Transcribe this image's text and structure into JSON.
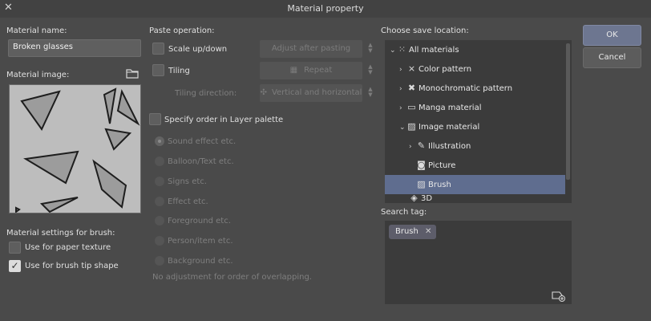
{
  "window": {
    "title": "Material property"
  },
  "left": {
    "material_name_label": "Material name:",
    "material_name_value": "Broken glasses",
    "material_image_label": "Material image:",
    "brush_settings_label": "Material settings for brush:",
    "paper_texture_label": "Use for paper texture",
    "paper_texture_checked": false,
    "brush_tip_label": "Use for brush tip shape",
    "brush_tip_checked": true,
    "check_mark": "✓"
  },
  "paste": {
    "label": "Paste operation:",
    "scale_label": "Scale up/down",
    "scale_value": "Adjust after pasting",
    "tiling_label": "Tiling",
    "tiling_value": "Repeat",
    "tiling_direction_label": "Tiling direction:",
    "tiling_direction_value": "Vertical and horizontal",
    "specify_order_label": "Specify order in Layer palette",
    "order_options": [
      "Sound effect etc.",
      "Balloon/Text etc.",
      "Signs etc.",
      "Effect etc.",
      "Foreground etc.",
      "Person/item etc.",
      "Background etc."
    ],
    "order_note": "No adjustment for order of overlapping."
  },
  "save": {
    "label": "Choose save location:",
    "tree": {
      "all_materials": "All materials",
      "color_pattern": "Color pattern",
      "monochromatic_pattern": "Monochromatic pattern",
      "manga_material": "Manga material",
      "image_material": "Image material",
      "illustration": "Illustration",
      "picture": "Picture",
      "brush": "Brush",
      "partial": "3D"
    },
    "selected": "Brush"
  },
  "search": {
    "label": "Search tag:",
    "tags": [
      "Brush"
    ],
    "remove_glyph": "✕"
  },
  "buttons": {
    "ok": "OK",
    "cancel": "Cancel"
  },
  "colors": {
    "background": "#4a4a4a",
    "panel": "#3b3b3b",
    "selection": "#5f6d8f",
    "primary_button": "#6d7690"
  }
}
